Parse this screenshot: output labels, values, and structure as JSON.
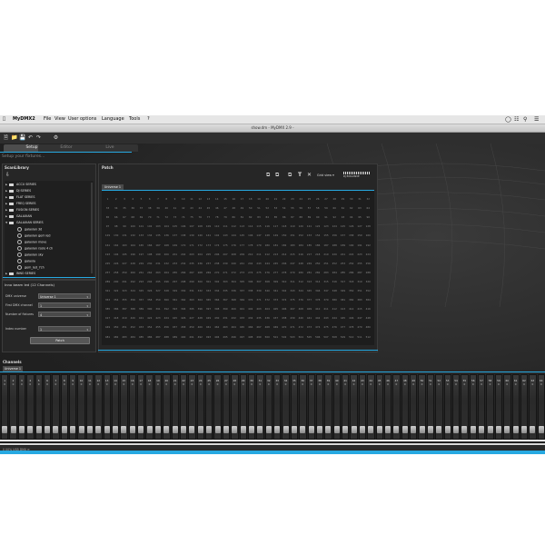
{
  "menubar": {
    "apple": "",
    "app_name": "MyDMX2",
    "items": [
      "File",
      "View",
      "User options",
      "Language",
      "Tools",
      "?"
    ]
  },
  "window": {
    "title": "show.dm - MyDMX 2.9 -"
  },
  "tabs": [
    {
      "label": "Setup",
      "active": true
    },
    {
      "label": "Editor",
      "active": false
    },
    {
      "label": "Live",
      "active": false
    }
  ],
  "setup_subtitle": "Setup your fixtures...",
  "scan_library": {
    "title": "ScanLibrary",
    "tree": [
      {
        "label": "ACCU SERIES",
        "type": "folder"
      },
      {
        "label": "DJ SERIES",
        "type": "folder"
      },
      {
        "label": "FLAT SERIES",
        "type": "folder"
      },
      {
        "label": "FREQ SERIES",
        "type": "folder"
      },
      {
        "label": "FUSION SERIES",
        "type": "folder"
      },
      {
        "label": "GALAXIAN",
        "type": "folder"
      },
      {
        "label": "GALAXIAN SERIES",
        "type": "folder-open"
      },
      {
        "label": "galaxian 3d",
        "type": "fixture"
      },
      {
        "label": "galaxian gem led",
        "type": "fixture"
      },
      {
        "label": "galaxian move",
        "type": "fixture"
      },
      {
        "label": "galaxian rsolo 4 ch",
        "type": "fixture"
      },
      {
        "label": "galaxian sky",
        "type": "fixture"
      },
      {
        "label": "galaxia",
        "type": "fixture"
      },
      {
        "label": "gem_led_7ch",
        "type": "fixture"
      },
      {
        "label": "INNO SERIES",
        "type": "folder"
      }
    ]
  },
  "fixture_config": {
    "title": "Inno beam led (12 Channels)",
    "fields": [
      {
        "label": "DMX universe",
        "value": "Universe 1",
        "dropdown": true
      },
      {
        "label": "First DMX channel",
        "value": "1",
        "dropdown": true
      },
      {
        "label": "Number of fixtures",
        "value": "4",
        "dropdown": true
      },
      {
        "label": "Index number",
        "value": "1",
        "dropdown": true
      }
    ],
    "patch_button": "Patch"
  },
  "patch": {
    "title": "Patch",
    "universe_tab": "Universe 1",
    "view_select": "Grid view",
    "brand": "DJ EXCLUSIVE",
    "total_channels": 512,
    "columns": 32
  },
  "channels": {
    "title": "Channels",
    "universe_tab": "Universe 1",
    "visible_count": 64,
    "values": "0"
  },
  "status_bar": {
    "text": "0 00% USB DMX ⟳"
  },
  "icons": [
    "new-file-icon",
    "open-folder-icon",
    "save-icon",
    "undo-icon",
    "redo-icon",
    "settings-icon",
    "copy-icon",
    "paste-icon",
    "text-icon",
    "delete-icon"
  ],
  "colors": {
    "accent": "#27a9e1",
    "panel_bg": "#262626",
    "menubar_bg": "#e6e6e6"
  }
}
